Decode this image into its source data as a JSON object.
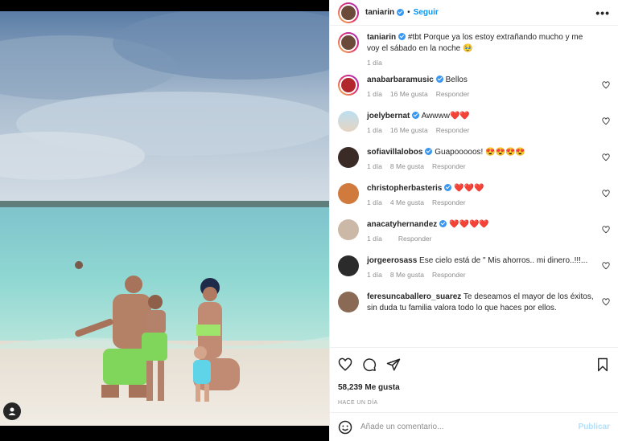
{
  "post": {
    "username": "taniarin",
    "follow_label": "Seguir",
    "separator": "•",
    "more_label": "•••",
    "caption_user": "taniarin",
    "caption": "#tbt Porque ya los estoy extrañando mucho y me voy el sábado en la noche 🥹",
    "caption_time": "1 día",
    "likes": "58,239 Me gusta",
    "posted": "Hace un día"
  },
  "comments": [
    {
      "user": "anabarbaramusic",
      "text": "Bellos",
      "time": "1 día",
      "likes": "16 Me gusta",
      "reply": "Responder"
    },
    {
      "user": "joelybernat",
      "text": "Awwww❤️❤️",
      "time": "1 día",
      "likes": "16 Me gusta",
      "reply": "Responder"
    },
    {
      "user": "sofiavillalobos",
      "text": "Guapooooos! 😍😍😍😍",
      "time": "1 día",
      "likes": "8 Me gusta",
      "reply": "Responder"
    },
    {
      "user": "christopherbasteris",
      "text": "❤️❤️❤️",
      "time": "1 día",
      "likes": "4 Me gusta",
      "reply": "Responder"
    },
    {
      "user": "anacatyhernandez",
      "text": "❤️❤️❤️❤️",
      "time": "1 día",
      "likes": "",
      "reply": "Responder"
    },
    {
      "user": "jorgeerosass",
      "text": "Ese cielo está de \" Mis ahorros.. mi dinero..!!!...",
      "time": "1 día",
      "likes": "8 Me gusta",
      "reply": "Responder"
    },
    {
      "user": "feresuncaballero_suarez",
      "text": "Te deseamos el mayor de los éxitos, sin duda tu familia valora todo lo que haces por ellos.",
      "time": "",
      "likes": "",
      "reply": ""
    }
  ],
  "add_comment": {
    "placeholder": "Añade un comentario...",
    "publish_label": "Publicar"
  },
  "icons": [
    "user-tag-icon",
    "more-icon",
    "heart-icon",
    "comment-icon",
    "share-icon",
    "bookmark-icon",
    "emoji-icon",
    "verified-icon"
  ],
  "colors": {
    "link": "#0095f6",
    "verified": "#3897f0",
    "publish_disabled": "#b2dffc"
  }
}
